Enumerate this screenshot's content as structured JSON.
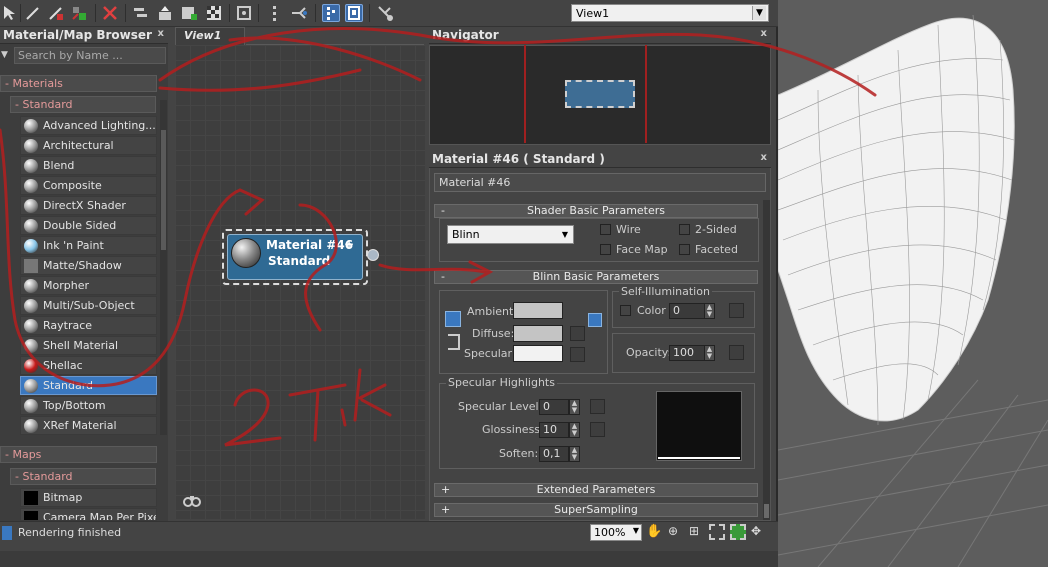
{
  "toolbar": {
    "view_select": "View1",
    "icons": [
      "cursor-icon",
      "eyedropper-icon",
      "put-material-icon",
      "assign-material-icon",
      "delete-icon",
      "move-children-icon",
      "hide-icon",
      "layout-icon",
      "background-icon",
      "lock-icon",
      "select-icon",
      "pick-icon",
      "align-icon",
      "options-icon",
      "show-end-icon",
      "pick-from-scene-icon"
    ]
  },
  "browser": {
    "title": "Material/Map Browser",
    "close": "x",
    "search_placeholder": "Search by Name ...",
    "group_materials": "- Materials",
    "group_standard": "- Standard",
    "materials": [
      {
        "label": "Advanced Lighting...",
        "swatch": "#9a9a9a"
      },
      {
        "label": "Architectural",
        "swatch": "#9a9a9a"
      },
      {
        "label": "Blend",
        "swatch": "#9a9a9a"
      },
      {
        "label": "Composite",
        "swatch": "#9a9a9a"
      },
      {
        "label": "DirectX Shader",
        "swatch": "#9a9a9a"
      },
      {
        "label": "Double Sided",
        "swatch": "#9a9a9a"
      },
      {
        "label": "Ink 'n Paint",
        "swatch": "#86c4e8"
      },
      {
        "label": "Matte/Shadow",
        "swatch": "#777777"
      },
      {
        "label": "Morpher",
        "swatch": "#9a9a9a"
      },
      {
        "label": "Multi/Sub-Object",
        "swatch": "#9a9a9a"
      },
      {
        "label": "Raytrace",
        "swatch": "#9a9a9a"
      },
      {
        "label": "Shell Material",
        "swatch": "#9a9a9a"
      },
      {
        "label": "Shellac",
        "swatch": "#c81818"
      },
      {
        "label": "Standard",
        "swatch": "#9a9a9a"
      },
      {
        "label": "Top/Bottom",
        "swatch": "#9a9a9a"
      },
      {
        "label": "XRef Material",
        "swatch": "#9a9a9a"
      }
    ],
    "group_maps": "- Maps",
    "group_maps_standard": "- Standard",
    "maps": [
      {
        "label": "Bitmap"
      },
      {
        "label": "Camera Map Per Pixel"
      }
    ]
  },
  "view": {
    "tab": "View1",
    "node_title": "Material #46",
    "node_type": "Standard",
    "node_plus": "+"
  },
  "navigator": {
    "title": "Navigator",
    "close": "x"
  },
  "params": {
    "title": "Material #46  ( Standard )",
    "close": "x",
    "name_field": "Material #46",
    "shader_rollout": "Shader Basic Parameters",
    "shader_select": "Blinn",
    "wire": "Wire",
    "two_sided": "2-Sided",
    "face_map": "Face Map",
    "faceted": "Faceted",
    "blinn_rollout": "Blinn Basic Parameters",
    "self_illum": "Self-Illumination",
    "ambient": "Ambient:",
    "diffuse": "Diffuse:",
    "specular": "Specular:",
    "color_label": "Color",
    "color_value": "0",
    "opacity_label": "Opacity:",
    "opacity_value": "100",
    "spec_highlights": "Specular Highlights",
    "spec_level_label": "Specular Level:",
    "spec_level_value": "0",
    "gloss_label": "Glossiness:",
    "gloss_value": "10",
    "soften_label": "Soften:",
    "soften_value": "0,1",
    "extended_rollout": "Extended Parameters",
    "supersampling_rollout": "SuperSampling",
    "ambient_color": "#c4c4c4",
    "diffuse_color": "#c4c4c4",
    "specular_color": "#f2f2f2"
  },
  "status": {
    "text": "Rendering finished",
    "zoom": "100%"
  },
  "annotation": {
    "text": "2 TIK",
    "color": "#b41e1e"
  }
}
